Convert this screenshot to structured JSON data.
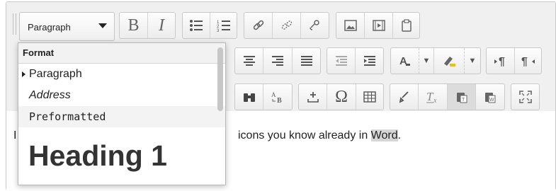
{
  "toolbar": {
    "format_select": {
      "value": "Paragraph"
    },
    "row1": [
      {
        "name": "bold-button",
        "glyph": "B"
      },
      {
        "name": "italic-button",
        "glyph": "I"
      },
      {
        "name": "bullet-list-button",
        "glyph": "☰"
      },
      {
        "name": "numbered-list-button",
        "glyph": "☰"
      },
      {
        "name": "insert-link-button",
        "glyph": "🔗"
      },
      {
        "name": "unlink-button",
        "glyph": "⛓"
      },
      {
        "name": "anchor-link-button",
        "glyph": "⚓"
      },
      {
        "name": "insert-image-button",
        "glyph": "▣"
      },
      {
        "name": "insert-media-button",
        "glyph": "▤"
      },
      {
        "name": "manage-files-button",
        "glyph": "⎘"
      }
    ],
    "row2": [
      {
        "name": "align-center-button",
        "glyph": "≡"
      },
      {
        "name": "align-right-button",
        "glyph": "≡"
      },
      {
        "name": "align-justify-button",
        "glyph": "≡"
      },
      {
        "name": "outdent-button",
        "glyph": "⇤"
      },
      {
        "name": "indent-button",
        "glyph": "⇥"
      },
      {
        "name": "text-color-button",
        "glyph": "A"
      },
      {
        "name": "text-color-dropdown",
        "glyph": "▾"
      },
      {
        "name": "background-color-button",
        "glyph": "✎"
      },
      {
        "name": "background-color-dropdown",
        "glyph": "▾"
      },
      {
        "name": "ltr-button",
        "glyph": "¶"
      },
      {
        "name": "rtl-button",
        "glyph": "¶"
      }
    ],
    "row3": [
      {
        "name": "find-button",
        "glyph": "🔍"
      },
      {
        "name": "find-replace-button",
        "glyph": "⇄"
      },
      {
        "name": "insert-hr-button",
        "glyph": "±"
      },
      {
        "name": "special-char-button",
        "glyph": "Ω"
      },
      {
        "name": "table-button",
        "glyph": "⊞"
      },
      {
        "name": "clean-html-button",
        "glyph": "✓"
      },
      {
        "name": "clear-format-button",
        "glyph": "T"
      },
      {
        "name": "paste-text-button",
        "glyph": "📋"
      },
      {
        "name": "paste-word-button",
        "glyph": "📋"
      },
      {
        "name": "fullscreen-button",
        "glyph": "⛶"
      }
    ]
  },
  "format_menu": {
    "header": "Format",
    "items": [
      {
        "label": "Paragraph"
      },
      {
        "label": "Address"
      },
      {
        "label": "Preformatted"
      },
      {
        "label": "Heading 1"
      }
    ]
  },
  "content": {
    "left_char": "I",
    "text_before": "icons you know already in ",
    "highlight": "Word",
    "text_after": "."
  }
}
